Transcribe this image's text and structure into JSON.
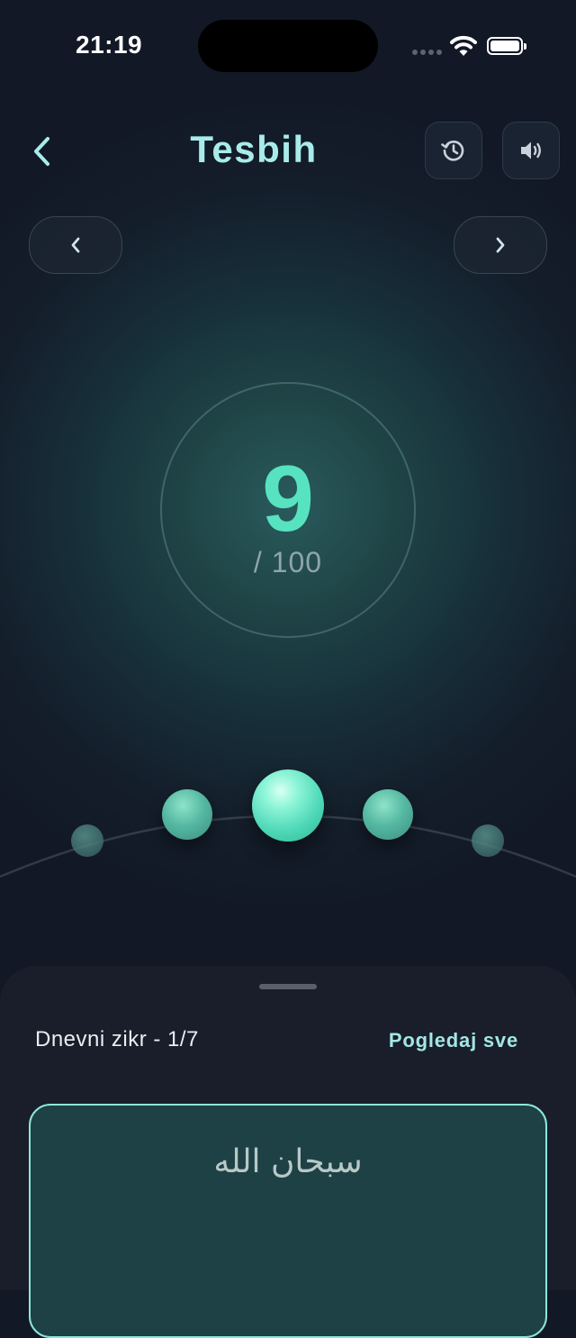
{
  "status_bar": {
    "time": "21:19"
  },
  "header": {
    "title": "Tesbih",
    "back_icon": "chevron-left-icon",
    "history_icon": "history-icon",
    "sound_icon": "speaker-icon"
  },
  "navigation": {
    "prev_icon": "chevron-left-icon",
    "next_icon": "chevron-right-icon"
  },
  "counter": {
    "count": "9",
    "target": "/ 100"
  },
  "daily_zikr": {
    "title": "Dnevni zikr - 1/7",
    "view_all": "Pogledaj sve",
    "current_arabic": "سبحان الله"
  },
  "colors": {
    "accent": "#57e3c0",
    "title": "#a8ecea",
    "card_border": "#8fe5dc",
    "background": "#121826"
  }
}
